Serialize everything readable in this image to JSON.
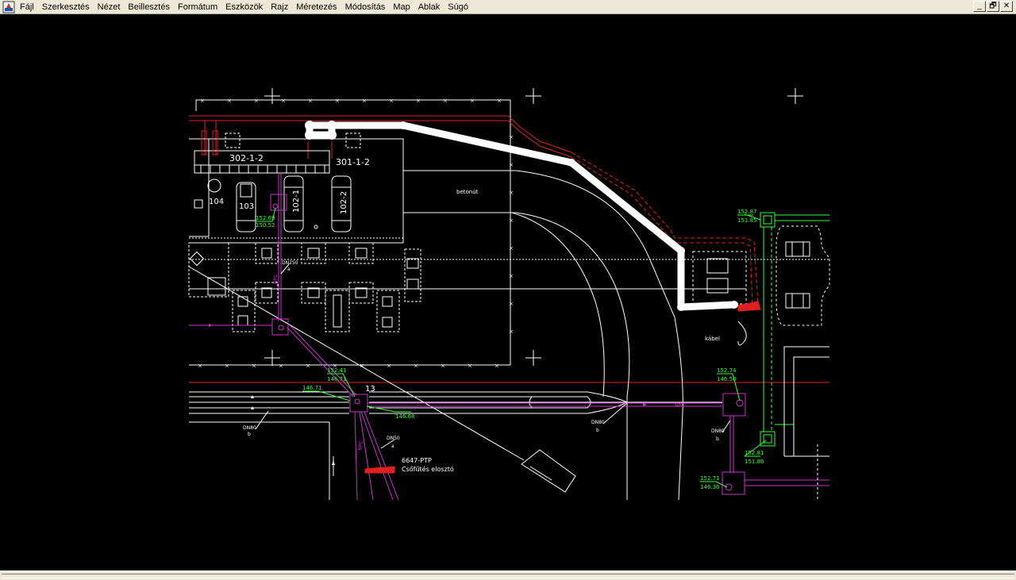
{
  "menu": {
    "items": [
      {
        "id": "file",
        "label": "Fájl"
      },
      {
        "id": "edit",
        "label": "Szerkesztés"
      },
      {
        "id": "view",
        "label": "Nézet"
      },
      {
        "id": "insert",
        "label": "Beillesztés"
      },
      {
        "id": "format",
        "label": "Formátum"
      },
      {
        "id": "tools",
        "label": "Eszközök"
      },
      {
        "id": "draw",
        "label": "Rajz"
      },
      {
        "id": "dimension",
        "label": "Méretezés"
      },
      {
        "id": "modify",
        "label": "Módosítás"
      },
      {
        "id": "map",
        "label": "Map"
      },
      {
        "id": "window",
        "label": "Ablak"
      },
      {
        "id": "help",
        "label": "Súgó"
      }
    ]
  },
  "window_buttons": {
    "minimize": "_",
    "restore": "🗗",
    "close": "✕"
  },
  "colors": {
    "background": "#000000",
    "line": "#ffffff",
    "pipe": "#cc33cc",
    "level": "#33ff33",
    "cable": "#ff2020",
    "highlight": "#ffffff",
    "menubar": "#ece9d8"
  },
  "drawing": {
    "building_labels": [
      "302-1-2",
      "301-1-2",
      "104",
      "103",
      "102-1",
      "102-2"
    ],
    "surface_label": "betonút",
    "cable_label": "kábel",
    "pipe_labels": [
      "DN250",
      "a",
      "DN80",
      "b",
      "DN80",
      "b",
      "DN80",
      "b",
      "DN50",
      "a",
      "NPC",
      "NPC",
      "NPC"
    ],
    "node_label": "13",
    "equipment": {
      "code": "6647-PTP",
      "name": "Csőfűtés elosztó"
    },
    "levels": [
      "152.69",
      "150.52",
      "152.41",
      "146.71",
      "146.71",
      "146.68",
      "152.74",
      "146.50",
      "152.81",
      "151.86",
      "152.71",
      "146.36",
      "152.87",
      "151.85"
    ]
  }
}
